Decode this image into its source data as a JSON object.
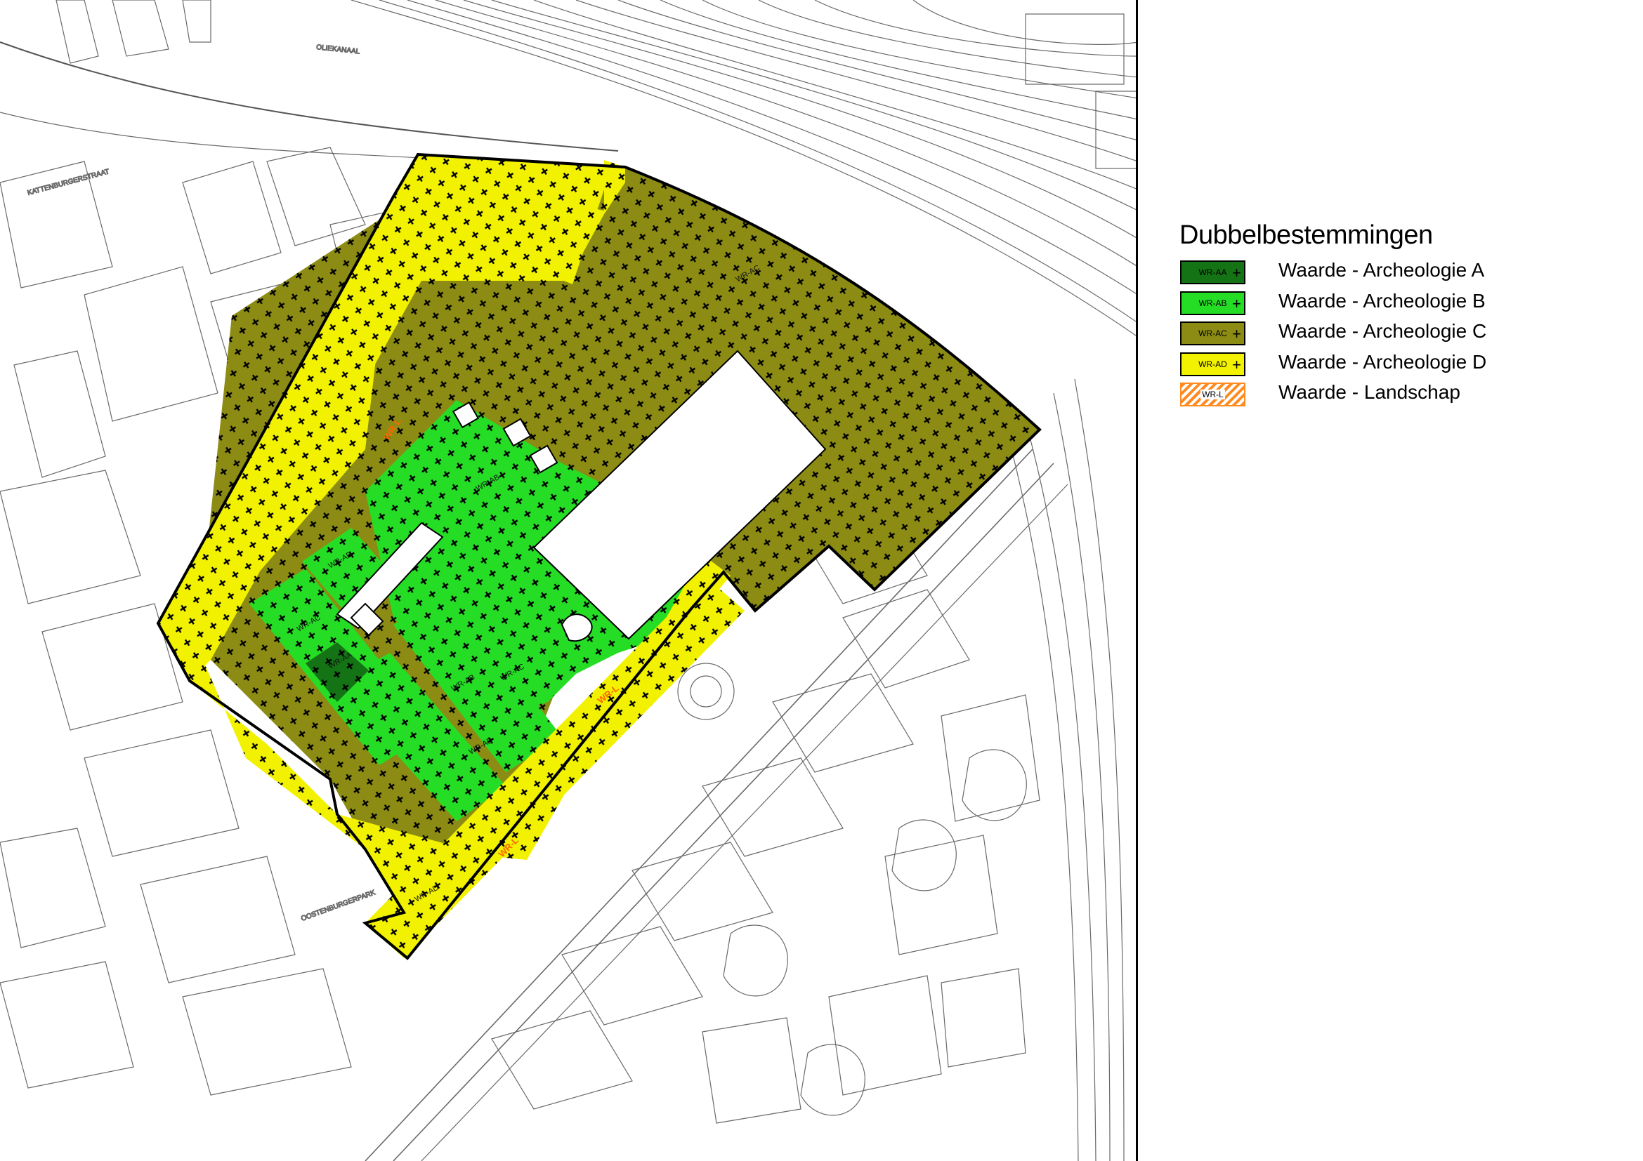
{
  "legend": {
    "title": "Dubbelbestemmingen",
    "items": [
      {
        "code": "WR-AA",
        "label": "Waarde - Archeologie A",
        "color": "#147314",
        "pattern": "cross"
      },
      {
        "code": "WR-AB",
        "label": "Waarde - Archeologie B",
        "color": "#26dd26",
        "pattern": "cross"
      },
      {
        "code": "WR-AC",
        "label": "Waarde - Archeologie C",
        "color": "#8c8c14",
        "pattern": "cross"
      },
      {
        "code": "WR-AD",
        "label": "Waarde - Archeologie D",
        "color": "#f2f200",
        "pattern": "cross"
      },
      {
        "code": "WR-L",
        "label": "Waarde - Landschap",
        "color": "#ff8a1f",
        "pattern": "hatch"
      }
    ]
  },
  "map": {
    "zone_labels": {
      "ad_top": "WR-AD",
      "ad_bottom": "WR-AD",
      "ac_main": "WR-AC",
      "ac_a": "WR-AC",
      "ac_b": "WR-AC",
      "ab_main": "WR-AB",
      "ab_a": "WR-AB",
      "ab_b": "WR-AB",
      "aa": "WR-AA",
      "landscape_a": "WR-L",
      "landscape_b": "WR-L",
      "landscape_c": "WR-L"
    },
    "colors": {
      "outline": "#000000",
      "basemap_line": "#6a6a6a"
    }
  }
}
